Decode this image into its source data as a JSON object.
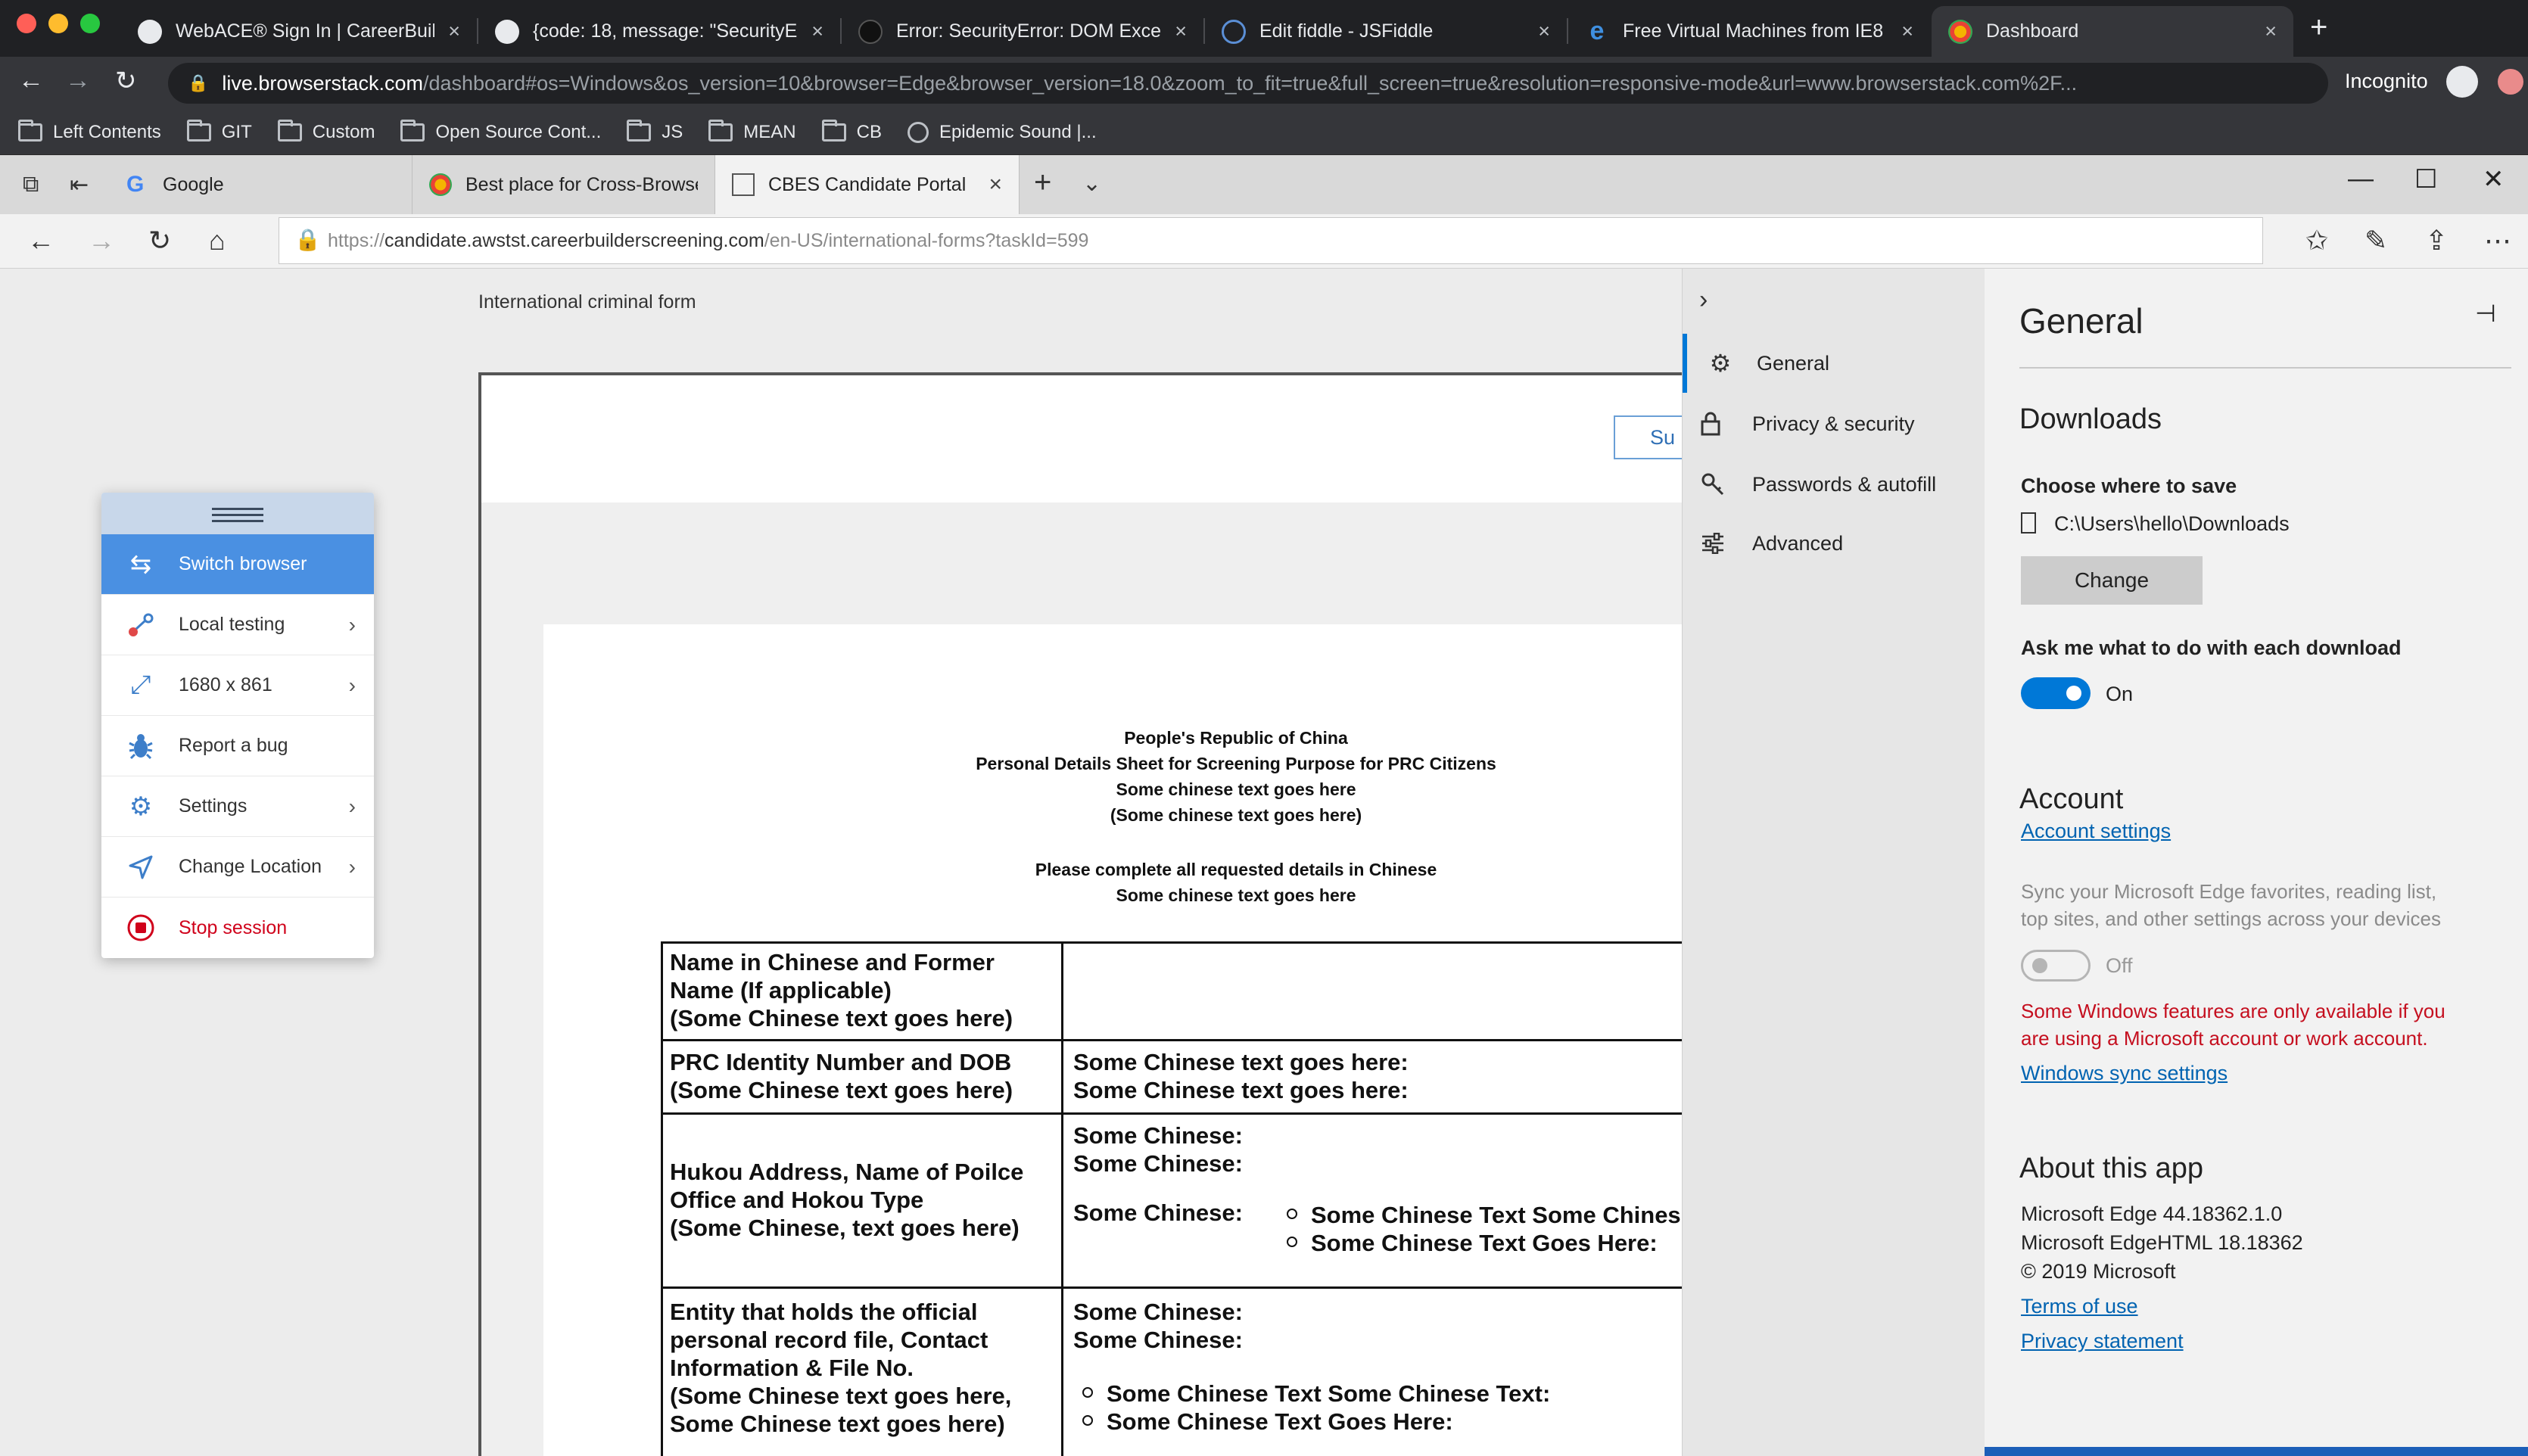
{
  "chrome": {
    "tabs": [
      {
        "title": "WebACE® Sign In | CareerBuild",
        "close": "×"
      },
      {
        "title": "{code: 18, message: \"SecurityE",
        "close": "×"
      },
      {
        "title": "Error: SecurityError: DOM Exce",
        "close": "×"
      },
      {
        "title": "Edit fiddle - JSFiddle",
        "close": "×"
      },
      {
        "title": "Free Virtual Machines from IE8",
        "close": "×"
      },
      {
        "title": "Dashboard",
        "close": "×"
      }
    ],
    "new_tab": "+",
    "url_host": "live.browserstack.com",
    "url_path": "/dashboard#os=Windows&os_version=10&browser=Edge&browser_version=18.0&zoom_to_fit=true&full_screen=true&resolution=responsive-mode&url=www.browserstack.com%2F...",
    "incognito_label": "Incognito",
    "bookmarks": [
      "Left Contents",
      "GIT",
      "Custom",
      "Open Source Cont...",
      "JS",
      "MEAN",
      "CB",
      "Epidemic Sound |..."
    ]
  },
  "edge": {
    "tabs": [
      {
        "title": "Google"
      },
      {
        "title": "Best place for Cross-Browse"
      },
      {
        "title": "CBES Candidate Portal",
        "close": "×"
      }
    ],
    "new_tab": "+",
    "url_prefix": "https://",
    "url_host": "candidate.awstst.careerbuilderscreening.com",
    "url_path": "/en-US/international-forms?taskId=599"
  },
  "page": {
    "form_title": "International criminal form",
    "submit_label": "Su",
    "header_lines": [
      "People's Republic of China",
      "Personal Details Sheet for Screening Purpose for PRC Citizens",
      "Some chinese text goes here",
      "(Some chinese text goes here)",
      "Please complete all requested details in Chinese",
      "Some chinese text goes here"
    ],
    "rows": [
      {
        "left": [
          "Name in Chinese and Former",
          "Name (If applicable)",
          "(Some Chinese text goes here)"
        ],
        "right": []
      },
      {
        "left": [
          "PRC Identity Number and DOB",
          "(Some Chinese text goes here)"
        ],
        "right": [
          "Some Chinese text goes here:",
          "Some Chinese text goes here:"
        ]
      },
      {
        "left": [
          "Hukou Address, Name of Poilce",
          "Office and Hokou Type",
          "(Some Chinese, text goes here)"
        ],
        "right": [
          "Some Chinese:",
          "Some Chinese:",
          "Some Chinese:"
        ],
        "bullets": [
          "Some Chinese Text Some Chines",
          "Some Chinese Text Goes Here:"
        ]
      },
      {
        "left": [
          "Entity that holds the official",
          "personal record file, Contact",
          "Information & File No.",
          "(Some Chinese text goes here,",
          "Some Chinese text goes here)"
        ],
        "right": [
          "Some Chinese:",
          "Some Chinese:"
        ],
        "bullets": [
          "Some Chinese Text Some Chinese Text:",
          "Some Chinese Text Goes Here:"
        ]
      }
    ]
  },
  "bs_menu": {
    "items": [
      {
        "label": "Switch browser",
        "icon": "switch-arrows-icon",
        "active": true
      },
      {
        "label": "Local testing",
        "icon": "local-testing-icon",
        "chevron": "›"
      },
      {
        "label": "1680 x 861",
        "icon": "resize-icon",
        "chevron": "›"
      },
      {
        "label": "Report a bug",
        "icon": "bug-icon"
      },
      {
        "label": "Settings",
        "icon": "gear-icon",
        "chevron": "›"
      },
      {
        "label": "Change Location",
        "icon": "location-arrow-icon",
        "chevron": "›"
      },
      {
        "label": "Stop session",
        "icon": "stop-icon"
      }
    ],
    "accent": "#4a90e2",
    "stop_color": "#d0021b"
  },
  "settings": {
    "nav": [
      {
        "label": "General",
        "icon": "gear-icon",
        "active": true
      },
      {
        "label": "Privacy & security",
        "icon": "lock-icon"
      },
      {
        "label": "Passwords & autofill",
        "icon": "key-icon"
      },
      {
        "label": "Advanced",
        "icon": "sliders-icon"
      }
    ],
    "title": "General",
    "downloads_heading": "Downloads",
    "choose_label": "Choose where to save",
    "download_path": "C:\\Users\\hello\\Downloads",
    "change_button": "Change",
    "ask_label": "Ask me what to do with each download",
    "ask_state": "On",
    "account_heading": "Account",
    "account_link": "Account settings",
    "sync_text_1": "Sync your Microsoft Edge favorites, reading list,",
    "sync_text_2": "top sites, and other settings across your devices",
    "sync_state": "Off",
    "warning_1": "Some Windows features are only available if you",
    "warning_2": "are using a Microsoft account or work account.",
    "sync_link": "Windows sync settings",
    "about_heading": "About this app",
    "version_1": "Microsoft Edge 44.18362.1.0",
    "version_2": "Microsoft EdgeHTML 18.18362",
    "copyright": "© 2019 Microsoft",
    "terms_link": "Terms of use",
    "privacy_link": "Privacy statement",
    "accent": "#0078d7",
    "warning_color": "#c50f1f"
  }
}
